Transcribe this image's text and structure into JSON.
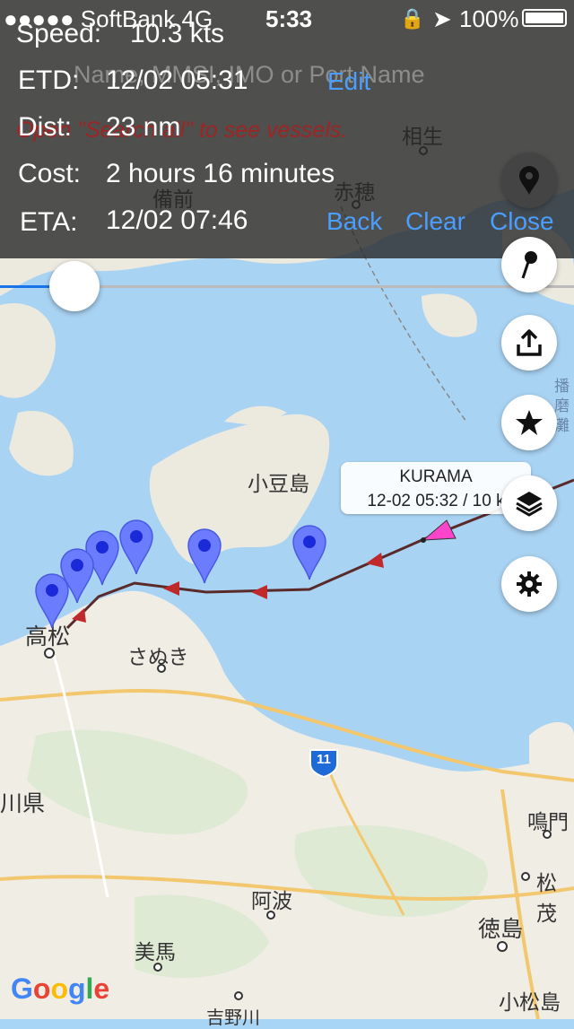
{
  "status_bar": {
    "carrier": "●●●●● SoftBank 4G",
    "time": "5:33",
    "battery": "100%"
  },
  "search_placeholder": "Name, MMSI, IMO or Port Name",
  "search_hint": "Open \"Search all\" to see vessels.",
  "info": {
    "speed_label": "Speed:",
    "speed_value": "10.3 kts",
    "etd_label": "ETD:",
    "etd_value": "12/02 05:31",
    "edit_label": "Edit",
    "dist_label": "Dist:",
    "dist_value": "23 nm",
    "cost_label": "Cost:",
    "cost_value": "2 hours 16 minutes",
    "eta_label": "ETA:",
    "eta_value": "12/02 07:46"
  },
  "actions": {
    "back": "Back",
    "clear": "Clear",
    "close": "Close"
  },
  "slider": {
    "value": 0.13
  },
  "vessel": {
    "name": "KURAMA",
    "detail": "12-02 05:32 / 10 k"
  },
  "map_labels": {
    "aioi": "相生",
    "ako": "赤穂",
    "bizen": "備前",
    "shodoshima": "小豆島",
    "takamatsu": "高松",
    "sanuki": "さぬき",
    "kagawa": "川県",
    "awa": "阿波",
    "mima": "美馬",
    "tokushima": "徳島",
    "naruto": "鳴門",
    "matsushige": "松茂",
    "komatsushima": "小松島",
    "yoshinogawa": "吉野川",
    "harima": "播磨灘",
    "route_11": "11"
  },
  "google_logo": "Google",
  "colors": {
    "accent": "#4a9eff",
    "panel": "#282828",
    "pin": "#6b7cff",
    "route": "#5a2a2a",
    "vessel": "#ff44cc"
  }
}
